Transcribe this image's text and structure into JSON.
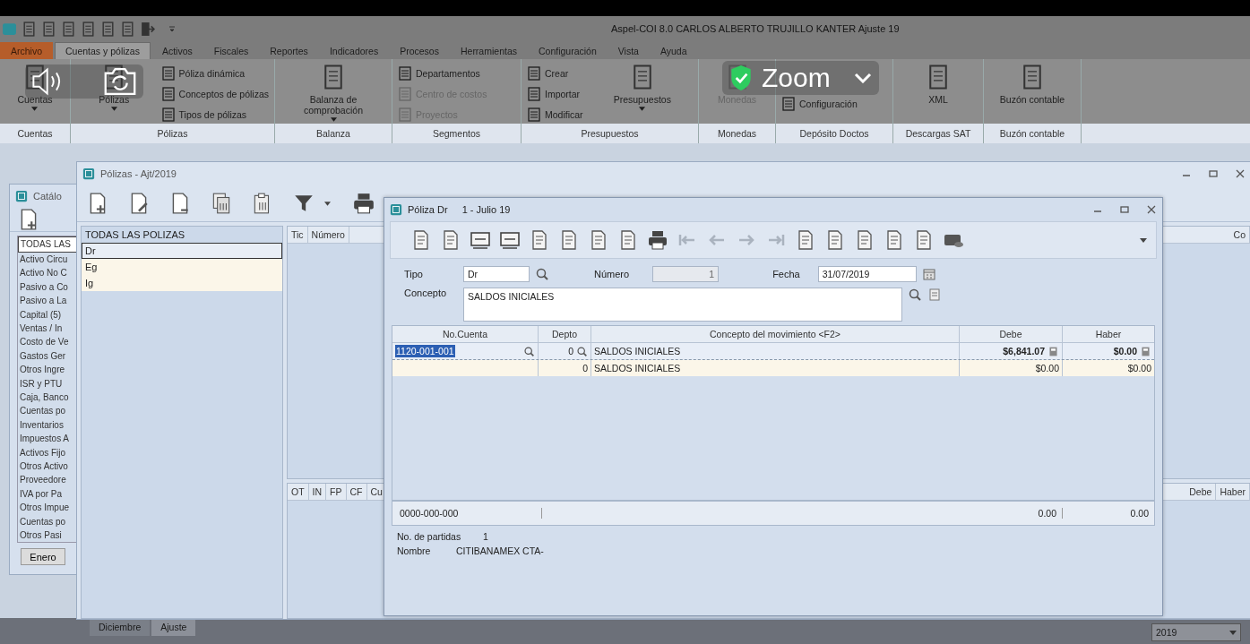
{
  "title_bar": {
    "title": "Aspel-COI 8.0 CARLOS ALBERTO TRUJILLO KANTER Ajuste 19"
  },
  "menu_tabs": [
    {
      "label": "Archivo",
      "kind": "file",
      "selected": false
    },
    {
      "label": "Cuentas y pólizas",
      "kind": "tab",
      "selected": true
    },
    {
      "label": "Activos",
      "kind": "tab",
      "selected": false
    },
    {
      "label": "Fiscales",
      "kind": "tab",
      "selected": false
    },
    {
      "label": "Reportes",
      "kind": "tab",
      "selected": false
    },
    {
      "label": "Indicadores",
      "kind": "tab",
      "selected": false
    },
    {
      "label": "Procesos",
      "kind": "tab",
      "selected": false
    },
    {
      "label": "Herramientas",
      "kind": "tab",
      "selected": false
    },
    {
      "label": "Configuración",
      "kind": "tab",
      "selected": false
    },
    {
      "label": "Vista",
      "kind": "tab",
      "selected": false
    },
    {
      "label": "Ayuda",
      "kind": "tab",
      "selected": false
    }
  ],
  "ribbon_groups": [
    {
      "label": "Cuentas",
      "columns": [
        {
          "kind": "large",
          "label": "Cuentas",
          "dropdown": true,
          "disabled": false
        }
      ]
    },
    {
      "label": "Pólizas",
      "columns": [
        {
          "kind": "large",
          "label": "Pólizas",
          "dropdown": true,
          "disabled": false
        },
        {
          "kind": "stack",
          "items": [
            {
              "label": "Póliza dinámica",
              "disabled": false
            },
            {
              "label": "Conceptos de pólizas",
              "disabled": false
            },
            {
              "label": "Tipos de pólizas",
              "disabled": false
            }
          ]
        }
      ]
    },
    {
      "label": "Balanza",
      "columns": [
        {
          "kind": "large",
          "label": "Balanza de comprobación",
          "dropdown": true,
          "disabled": false
        }
      ]
    },
    {
      "label": "Segmentos",
      "columns": [
        {
          "kind": "stack",
          "items": [
            {
              "label": "Departamentos",
              "disabled": false
            },
            {
              "label": "Centro de costos",
              "disabled": true
            },
            {
              "label": "Proyectos",
              "disabled": true
            }
          ]
        }
      ]
    },
    {
      "label": "Presupuestos",
      "columns": [
        {
          "kind": "stack",
          "items": [
            {
              "label": "Crear",
              "disabled": false
            },
            {
              "label": "Importar",
              "disabled": false
            },
            {
              "label": "Modificar",
              "disabled": false
            }
          ]
        },
        {
          "kind": "large",
          "label": "Presupuestos",
          "dropdown": true,
          "disabled": false
        }
      ]
    },
    {
      "label": "Monedas",
      "columns": [
        {
          "kind": "large",
          "label": "Monedas",
          "dropdown": false,
          "disabled": true
        }
      ]
    },
    {
      "label": "Depósito Doctos",
      "columns": [
        {
          "kind": "stack",
          "items": [
            {
              "label": "Configuración",
              "disabled": false
            }
          ]
        }
      ]
    },
    {
      "label": "Descargas SAT",
      "columns": [
        {
          "kind": "large",
          "label": "XML",
          "dropdown": false,
          "disabled": false
        }
      ]
    },
    {
      "label": "Buzón contable",
      "columns": [
        {
          "kind": "large",
          "label": "Buzón contable",
          "dropdown": false,
          "disabled": false
        }
      ]
    }
  ],
  "overlay": {
    "label": "Zoom"
  },
  "catalog_window": {
    "title": "Catálo",
    "items": [
      {
        "label": "TODAS LAS",
        "selected": true
      },
      {
        "label": "Activo Circu",
        "selected": false
      },
      {
        "label": "Activo No C",
        "selected": false
      },
      {
        "label": "Pasivo a Co",
        "selected": false
      },
      {
        "label": "Pasivo a La",
        "selected": false
      },
      {
        "label": "Capital (5)",
        "selected": false
      },
      {
        "label": "Ventas / In",
        "selected": false
      },
      {
        "label": "Costo de Ve",
        "selected": false
      },
      {
        "label": "Gastos Ger",
        "selected": false
      },
      {
        "label": "Otros Ingre",
        "selected": false
      },
      {
        "label": "ISR y PTU",
        "selected": false
      },
      {
        "label": "Caja, Banco",
        "selected": false
      },
      {
        "label": "Cuentas po",
        "selected": false
      },
      {
        "label": "Inventarios",
        "selected": false
      },
      {
        "label": "Impuestos A",
        "selected": false
      },
      {
        "label": "Activos Fijo",
        "selected": false
      },
      {
        "label": "Otros Activo",
        "selected": false
      },
      {
        "label": "Proveedore",
        "selected": false
      },
      {
        "label": "IVA por Pa",
        "selected": false
      },
      {
        "label": "Otros Impue",
        "selected": false
      },
      {
        "label": "Cuentas po",
        "selected": false
      },
      {
        "label": "Otros Pasi",
        "selected": false
      }
    ],
    "button": "Enero"
  },
  "polizas_window": {
    "title": "Pólizas - Ajt/2019",
    "types": [
      {
        "label": "TODAS LAS POLIZAS",
        "selected": false
      },
      {
        "label": "Dr",
        "selected": true
      },
      {
        "label": "Eg",
        "selected": false
      },
      {
        "label": "Ig",
        "selected": false
      }
    ],
    "grid_columns": [
      "Tic",
      "Número"
    ],
    "right_column": "Co",
    "detail_columns": [
      "OT",
      "IN",
      "FP",
      "CF",
      "Cu"
    ],
    "right_detail_columns": [
      "Debe",
      "Haber"
    ]
  },
  "poliza_dialog": {
    "title": "Póliza Dr",
    "subtitle": "1 - Julio 19",
    "tipo_label": "Tipo",
    "tipo": "Dr",
    "numero_label": "Número",
    "numero": "1",
    "fecha_label": "Fecha",
    "fecha": "31/07/2019",
    "concepto_label": "Concepto",
    "concepto": "SALDOS INICIALES",
    "columns": [
      "No.Cuenta",
      "Depto",
      "Concepto del movimiento <F2>",
      "Debe",
      "Haber"
    ],
    "rows": [
      {
        "cuenta": "1120-001-001",
        "depto": "0",
        "concepto": "SALDOS INICIALES",
        "debe": "$6,841.07",
        "haber": "$0.00",
        "selected": true
      },
      {
        "cuenta": "",
        "depto": "0",
        "concepto": "SALDOS INICIALES",
        "debe": "$0.00",
        "haber": "$0.00",
        "selected": false
      }
    ],
    "footer": {
      "cuenta": "0000-000-000",
      "debe": "0.00",
      "haber": "0.00"
    },
    "partidas_label": "No. de partidas",
    "partidas": "1",
    "nombre_label": "Nombre",
    "nombre": "CITIBANAMEX CTA-"
  },
  "period_tabs": [
    {
      "label": "Diciembre",
      "selected": false
    },
    {
      "label": "Ajuste",
      "selected": true
    }
  ],
  "year": "2019"
}
